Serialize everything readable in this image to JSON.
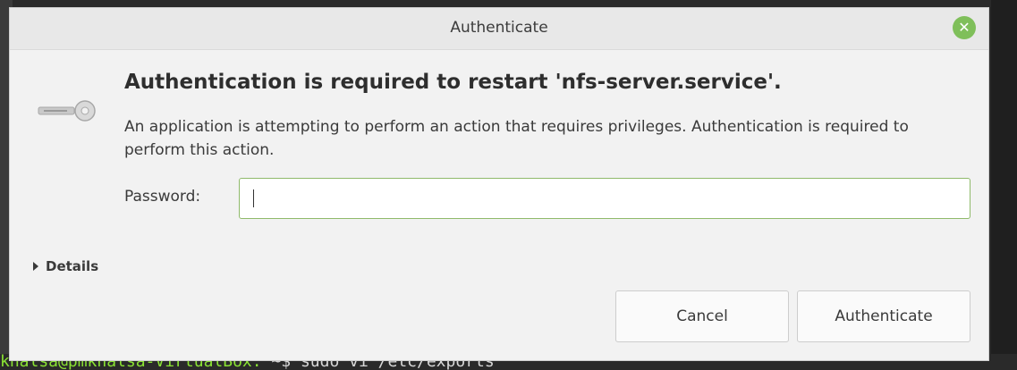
{
  "window": {
    "title": "Authenticate",
    "close_glyph": "✕"
  },
  "dialog": {
    "icon": "key-icon",
    "heading": "Authentication is required to restart 'nfs-server.service'.",
    "description": "An application is attempting to perform an action that requires privileges. Authentication is required to perform this action.",
    "password_label": "Password:",
    "password_value": "",
    "details_label": "Details",
    "cancel_label": "Cancel",
    "authenticate_label": "Authenticate"
  },
  "terminal": {
    "prompt": "khalsa@pmkhalsa-VirtualBox:",
    "command": "~$ sudo vi /etc/exports"
  },
  "colors": {
    "close_button": "#7fbf5a",
    "input_focus_border": "#8fba6a"
  }
}
